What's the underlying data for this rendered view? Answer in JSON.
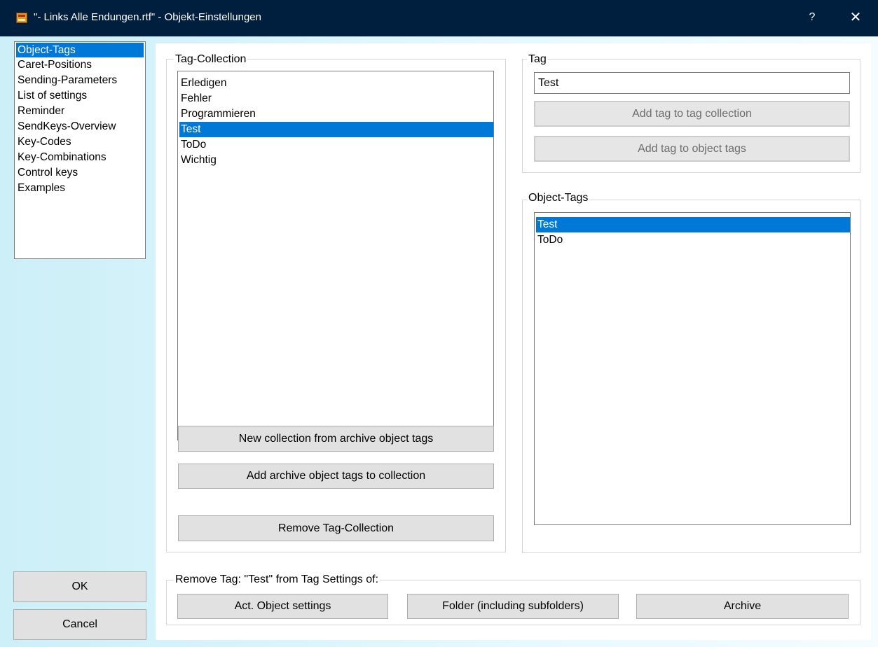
{
  "window": {
    "title": "\"- Links Alle Endungen.rtf\" - Objekt-Einstellungen",
    "help_label": "?",
    "close_label": "✕"
  },
  "sidebar": {
    "items": [
      {
        "label": "Object-Tags",
        "selected": true
      },
      {
        "label": "Caret-Positions"
      },
      {
        "label": "Sending-Parameters"
      },
      {
        "label": "List of settings"
      },
      {
        "label": "Reminder"
      },
      {
        "label": "SendKeys-Overview"
      },
      {
        "label": "Key-Codes"
      },
      {
        "label": "Key-Combinations"
      },
      {
        "label": "Control keys"
      },
      {
        "label": "Examples"
      }
    ]
  },
  "buttons": {
    "ok": "OK",
    "cancel": "Cancel"
  },
  "tag_collection": {
    "label": "Tag-Collection",
    "items": [
      "Erledigen",
      "Fehler",
      "Programmieren",
      "Test",
      "ToDo",
      "Wichtig"
    ],
    "selected": "Test",
    "new_collection_button": "New collection from archive object tags",
    "add_archive_button": "Add archive object tags to collection",
    "remove_collection_button": "Remove Tag-Collection"
  },
  "tag": {
    "label": "Tag",
    "value": "Test",
    "add_to_collection_button": "Add tag to tag collection",
    "add_to_object_button": "Add tag to object tags"
  },
  "object_tags": {
    "label": "Object-Tags",
    "items": [
      "Test",
      "ToDo"
    ],
    "selected": "Test"
  },
  "remove_tag": {
    "label": "Remove Tag: \"Test\" from Tag Settings of:",
    "act_object_button": "Act. Object settings",
    "folder_button": "Folder (including subfolders)",
    "archive_button": "Archive"
  },
  "colors": {
    "titlebar": "#001f3f",
    "selection": "#0078d7",
    "button_face": "#e1e1e1"
  }
}
